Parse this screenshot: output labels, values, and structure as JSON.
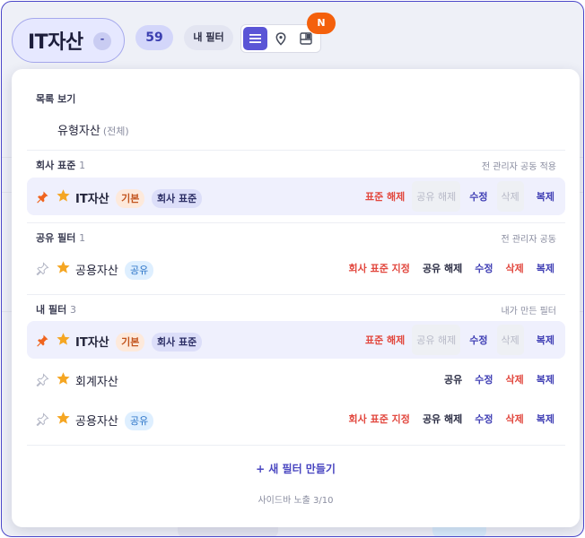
{
  "header": {
    "title": "IT자산",
    "caret": "-",
    "count": "59",
    "my_filter_label": "내 필터",
    "new_badge": "N",
    "view_icons": [
      "list-icon",
      "map-pin-icon",
      "layout-icon"
    ]
  },
  "panel": {
    "list_view_label": "목록 보기",
    "type_asset": {
      "name": "유형자산",
      "sub": "(전체)"
    },
    "sections": {
      "company": {
        "title": "회사 표준",
        "count": "1",
        "note": "전 관리자 공동 적용"
      },
      "shared": {
        "title": "공유 필터",
        "count": "1",
        "note": "전 관리자 공동"
      },
      "mine": {
        "title": "내 필터",
        "count": "3",
        "note": "내가 만든 필터"
      }
    },
    "rows": [
      {
        "name": "IT자산",
        "tag1": "기본",
        "tag2": "회사 표준",
        "actions": [
          "표준 해제",
          "공유 해제",
          "수정",
          "삭제",
          "복제"
        ]
      },
      {
        "name": "공용자산",
        "tag1": "공유",
        "actions": [
          "회사 표준 지정",
          "공유 해제",
          "수정",
          "삭제",
          "복제"
        ]
      },
      {
        "name": "IT자산",
        "tag1": "기본",
        "tag2": "회사 표준",
        "actions": [
          "표준 해제",
          "공유 해제",
          "수정",
          "삭제",
          "복제"
        ]
      },
      {
        "name": "회계자산",
        "actions": [
          "공유",
          "수정",
          "삭제",
          "복제"
        ]
      },
      {
        "name": "공용자산",
        "tag1": "공유",
        "actions": [
          "회사 표준 지정",
          "공유 해제",
          "수정",
          "삭제",
          "복제"
        ]
      }
    ],
    "new_filter": "+ 새 필터 만들기",
    "sidebar_note": "사이드바 노출 3/10"
  },
  "colors": {
    "accent": "#5a55d6",
    "danger": "#e2483f",
    "link": "#4140b5",
    "new_badge": "#f4600c",
    "star": "#f5a623",
    "pin_active": "#f0641e"
  }
}
